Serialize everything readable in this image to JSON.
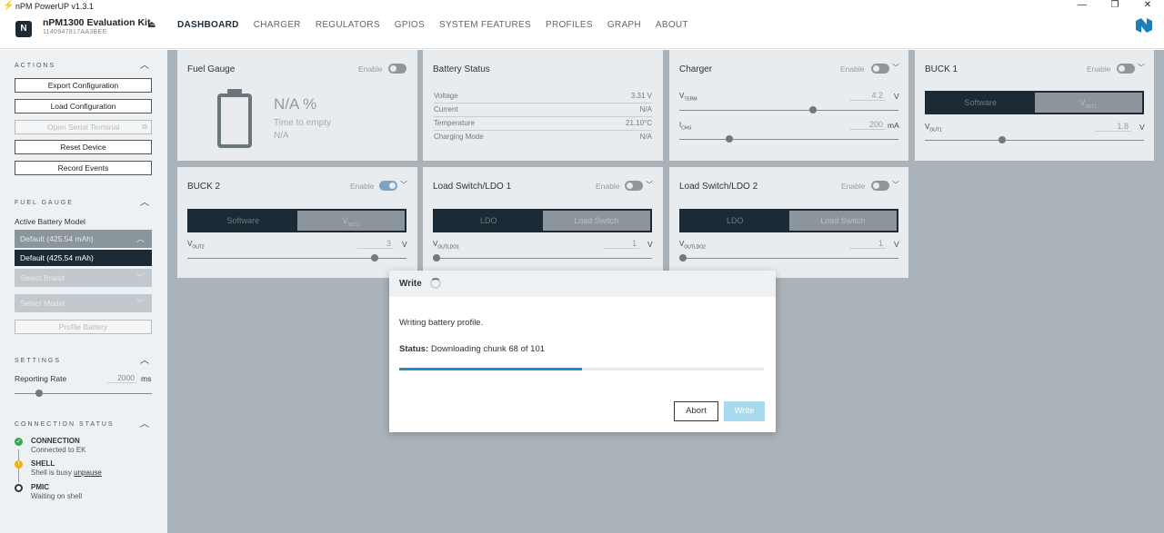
{
  "window": {
    "title": "nPM PowerUP v1.3.1",
    "minimize": "—",
    "maximize": "❐",
    "close": "✕"
  },
  "header": {
    "device_name": "nPM1300 Evaluation Kit",
    "device_serial": "1140947817AA3BEE",
    "nav": [
      "DASHBOARD",
      "CHARGER",
      "REGULATORS",
      "GPIOS",
      "SYSTEM FEATURES",
      "PROFILES",
      "GRAPH",
      "ABOUT"
    ],
    "active_nav": "DASHBOARD"
  },
  "sidebar": {
    "actions": {
      "heading": "ACTIONS",
      "export": "Export Configuration",
      "load": "Load Configuration",
      "open_terminal": "Open Serial Terminal",
      "reset": "Reset Device",
      "record": "Record Events"
    },
    "fuel_gauge": {
      "heading": "FUEL GAUGE",
      "model_label": "Active Battery Model",
      "model_value": "Default (425.54 mAh)",
      "model_option": "Default (425.54 mAh)",
      "brand_placeholder": "Select Brand",
      "model_placeholder": "Select Model",
      "profile_button": "Profile Battery"
    },
    "settings": {
      "heading": "SETTINGS",
      "rate_label": "Reporting Rate",
      "rate_value": "2000",
      "rate_unit": "ms"
    },
    "connection": {
      "heading": "CONNECTION STATUS",
      "items": [
        {
          "title": "CONNECTION",
          "sub": "Connected to EK",
          "color": "#3aa657"
        },
        {
          "title": "SHELL",
          "sub": "Shell is busy",
          "link": "unpause",
          "color": "#f0b400"
        },
        {
          "title": "PMIC",
          "sub": "Waiting on shell",
          "color": "#333333"
        }
      ]
    }
  },
  "cards": {
    "fuel_gauge": {
      "title": "Fuel Gauge",
      "enable": "Enable",
      "pct": "N/A %",
      "tte_label": "Time to empty",
      "tte_value": "N/A"
    },
    "battery_status": {
      "title": "Battery Status",
      "rows": [
        {
          "k": "Voltage",
          "v": "3.31 V"
        },
        {
          "k": "Current",
          "v": "N/A"
        },
        {
          "k": "Temperature",
          "v": "21.10°C"
        },
        {
          "k": "Charging Mode",
          "v": "N/A"
        }
      ]
    },
    "charger": {
      "title": "Charger",
      "enable": "Enable",
      "vterm_label": "V",
      "vterm_sub": "TERM",
      "vterm_value": "4.2",
      "vterm_unit": "V",
      "ichg_label": "I",
      "ichg_sub": "CHG",
      "ichg_value": "200",
      "ichg_unit": "mA"
    },
    "buck1": {
      "title": "BUCK 1",
      "enable": "Enable",
      "opt_a": "Software",
      "opt_b": "V",
      "opt_b_sub": "SET1",
      "vout_label": "V",
      "vout_sub": "OUT1",
      "vout_value": "1.8",
      "vout_unit": "V"
    },
    "buck2": {
      "title": "BUCK 2",
      "enable": "Enable",
      "opt_a": "Software",
      "opt_b": "V",
      "opt_b_sub": "SET2",
      "vout_label": "V",
      "vout_sub": "OUT2",
      "vout_value": "3",
      "vout_unit": "V"
    },
    "ldo1": {
      "title": "Load Switch/LDO 1",
      "enable": "Enable",
      "opt_a": "LDO",
      "opt_b": "Load Switch",
      "vout_label": "V",
      "vout_sub": "OUTLDO1",
      "vout_value": "1",
      "vout_unit": "V"
    },
    "ldo2": {
      "title": "Load Switch/LDO 2",
      "enable": "Enable",
      "opt_a": "LDO",
      "opt_b": "Load Switch",
      "vout_label": "V",
      "vout_sub": "OUTLDO2",
      "vout_value": "1",
      "vout_unit": "V"
    }
  },
  "dialog": {
    "title": "Write",
    "message": "Writing battery profile.",
    "status_label": "Status:",
    "status_value": "Downloading chunk 68 of 101",
    "progress": 0.5,
    "abort": "Abort",
    "write": "Write"
  }
}
